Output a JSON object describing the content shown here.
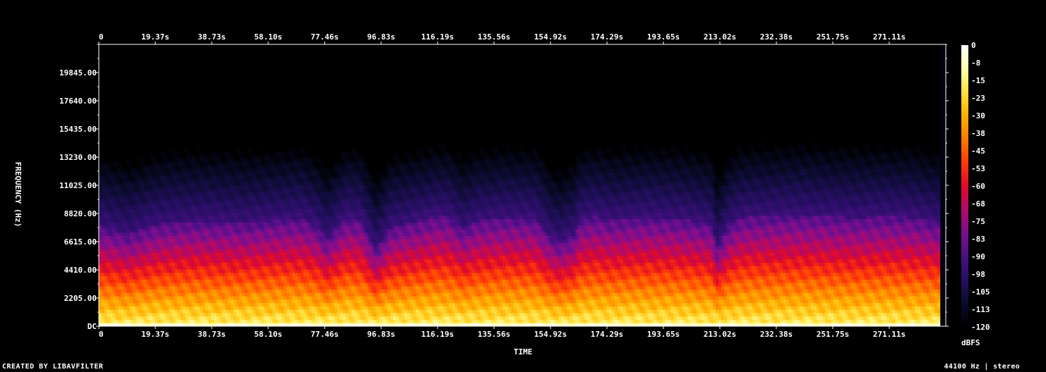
{
  "chart_data": {
    "type": "heatmap",
    "title": "",
    "xlabel": "TIME",
    "ylabel": "FREQUENCY (Hz)",
    "x_ticks": [
      "0",
      "19.37s",
      "38.73s",
      "58.10s",
      "77.46s",
      "96.83s",
      "116.19s",
      "135.56s",
      "154.92s",
      "174.29s",
      "193.65s",
      "213.02s",
      "232.38s",
      "251.75s",
      "271.11s"
    ],
    "x_tick_values": [
      0,
      19.37,
      38.73,
      58.1,
      77.46,
      96.83,
      116.19,
      135.56,
      154.92,
      174.29,
      193.65,
      213.02,
      232.38,
      251.75,
      271.11
    ],
    "xlim": [
      0,
      290.5
    ],
    "y_ticks": [
      "DC",
      "2205.00",
      "4410.00",
      "6615.00",
      "8820.00",
      "11025.00",
      "13230.00",
      "15435.00",
      "17640.00",
      "19845.00"
    ],
    "y_tick_values": [
      0,
      2205,
      4410,
      6615,
      8820,
      11025,
      13230,
      15435,
      17640,
      19845
    ],
    "ylim": [
      0,
      22050
    ],
    "colorbar": {
      "label": "dBFS",
      "ticks": [
        "0",
        "-8",
        "-15",
        "-23",
        "-30",
        "-38",
        "-45",
        "-53",
        "-60",
        "-68",
        "-75",
        "-83",
        "-90",
        "-98",
        "-105",
        "-113",
        "-120"
      ],
      "range": [
        -120,
        0
      ]
    },
    "colormap": [
      "#000000",
      "#0b0b2e",
      "#240f60",
      "#4a0f86",
      "#7a0f8f",
      "#b00a6a",
      "#e00a2a",
      "#ff3a08",
      "#ff7a00",
      "#ffb000",
      "#ffe040",
      "#ffffa8",
      "#ffffff"
    ],
    "energy_edge_khz": {
      "times": [
        0,
        10,
        20,
        30,
        40,
        50,
        60,
        70,
        75,
        78,
        85,
        90,
        95,
        100,
        105,
        110,
        115,
        120,
        125,
        130,
        140,
        150,
        155,
        158,
        163,
        165,
        170,
        175,
        180,
        190,
        200,
        210,
        212,
        216,
        220,
        225,
        230,
        240,
        250,
        260,
        270,
        280,
        288
      ],
      "values": [
        7.8,
        7.2,
        8.0,
        8.2,
        8.2,
        8.1,
        8.3,
        8.4,
        7.8,
        6.8,
        8.5,
        8.3,
        6.0,
        7.7,
        8.0,
        8.3,
        8.6,
        8.6,
        7.6,
        8.3,
        8.5,
        8.4,
        7.0,
        6.6,
        7.2,
        8.3,
        8.6,
        8.3,
        8.4,
        8.5,
        8.4,
        8.0,
        6.2,
        7.8,
        8.5,
        8.6,
        8.6,
        8.7,
        8.6,
        8.5,
        8.6,
        8.5,
        8.1
      ]
    }
  },
  "footer": {
    "left": "CREATED BY LIBAVFILTER",
    "right": "44100 Hz | stereo"
  }
}
